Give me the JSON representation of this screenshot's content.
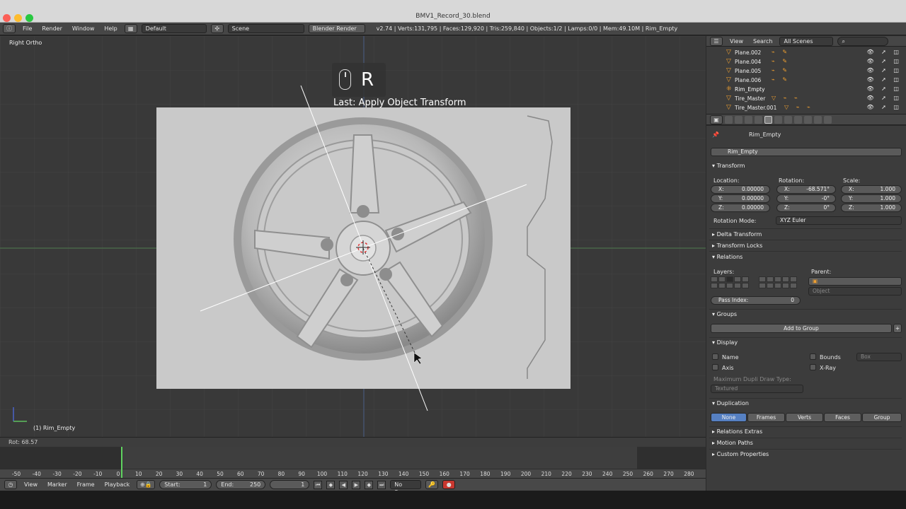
{
  "window": {
    "title": "BMV1_Record_30.blend"
  },
  "info_header": {
    "menus": [
      "File",
      "Render",
      "Window",
      "Help"
    ],
    "screen_layout": "Default",
    "scene": "Scene",
    "render_engine": "Blender Render",
    "stats": "v2.74 | Verts:131,795 | Faces:129,920 | Tris:259,840 | Objects:1/2 | Lamps:0/0 | Mem:49.10M | Rim_Empty"
  },
  "viewport": {
    "view_label": "Right Ortho",
    "object_label": "(1) Rim_Empty",
    "keycast_key": "R",
    "last_operation": "Last: Apply Object Transform",
    "status": "Rot: 68.57"
  },
  "timeline": {
    "ticks": [
      "-50",
      "-40",
      "-30",
      "-20",
      "-10",
      "0",
      "10",
      "20",
      "30",
      "40",
      "50",
      "60",
      "70",
      "80",
      "90",
      "100",
      "110",
      "120",
      "130",
      "140",
      "150",
      "160",
      "170",
      "180",
      "190",
      "200",
      "210",
      "220",
      "230",
      "240",
      "250",
      "260",
      "270",
      "280"
    ],
    "menus": [
      "View",
      "Marker",
      "Frame",
      "Playback"
    ],
    "start_label": "Start:",
    "start_value": "1",
    "end_label": "End:",
    "end_value": "250",
    "current_frame": "1",
    "sync": "No Sync"
  },
  "outliner": {
    "menus": [
      "View",
      "Search"
    ],
    "filter": "All Scenes",
    "items": [
      "Plane.002",
      "Plane.004",
      "Plane.005",
      "Plane.006",
      "Rim_Empty",
      "Tire_Master",
      "Tire_Master.001"
    ]
  },
  "properties": {
    "breadcrumb": "Rim_Empty",
    "object_name": "Rim_Empty",
    "transform": {
      "title": "Transform",
      "location_label": "Location:",
      "rotation_label": "Rotation:",
      "scale_label": "Scale:",
      "location": [
        {
          "axis": "X:",
          "value": "0.00000"
        },
        {
          "axis": "Y:",
          "value": "0.00000"
        },
        {
          "axis": "Z:",
          "value": "0.00000"
        }
      ],
      "rotation": [
        {
          "axis": "X:",
          "value": "-68.571°"
        },
        {
          "axis": "Y:",
          "value": "-0°"
        },
        {
          "axis": "Z:",
          "value": "0°"
        }
      ],
      "scale": [
        {
          "axis": "X:",
          "value": "1.000"
        },
        {
          "axis": "Y:",
          "value": "1.000"
        },
        {
          "axis": "Z:",
          "value": "1.000"
        }
      ],
      "rotation_mode_label": "Rotation Mode:",
      "rotation_mode": "XYZ Euler"
    },
    "panels": {
      "delta_transform": "Delta Transform",
      "transform_locks": "Transform Locks",
      "relations": "Relations",
      "groups": "Groups",
      "display": "Display",
      "duplication": "Duplication",
      "relations_extras": "Relations Extras",
      "motion_paths": "Motion Paths",
      "custom_properties": "Custom Properties"
    },
    "relations": {
      "layers_label": "Layers:",
      "parent_label": "Parent:",
      "parent_type": "Object",
      "pass_index_label": "Pass Index:",
      "pass_index_value": "0"
    },
    "groups": {
      "add_button": "Add to Group"
    },
    "display": {
      "name": "Name",
      "axis": "Axis",
      "bounds": "Bounds",
      "bounds_type": "Box",
      "xray": "X-Ray",
      "max_dupli_label": "Maximum Dupli Draw Type:",
      "max_dupli_value": "Textured"
    },
    "duplication": {
      "options": [
        "None",
        "Frames",
        "Verts",
        "Faces",
        "Group"
      ],
      "selected": "None"
    }
  },
  "colors": {
    "accent": "#5680c2",
    "frame_cursor": "#5fd35f",
    "object_orange": "#f0a030"
  }
}
